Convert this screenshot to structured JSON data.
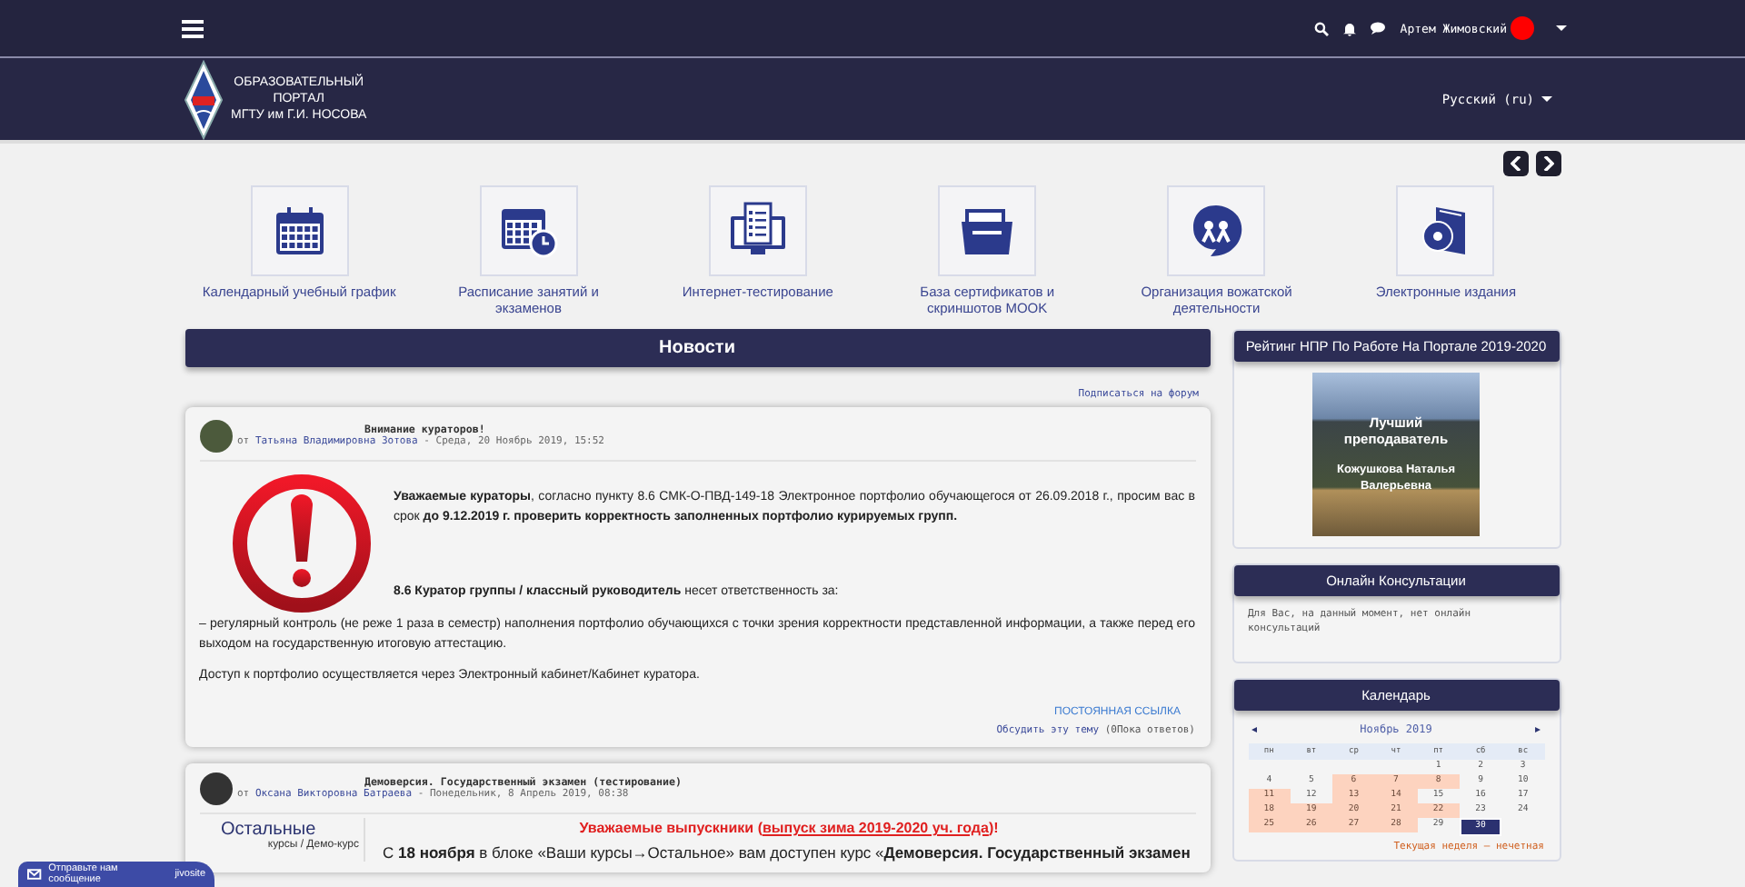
{
  "topbar": {
    "user_name": "Артем Жимовский"
  },
  "header": {
    "logo_text": [
      "ОБРАЗОВАТЕЛЬНЫЙ",
      "ПОРТАЛ",
      "МГТУ им Г.И. НОСОВА"
    ],
    "language": "Русский (ru)"
  },
  "tiles": [
    {
      "label": "Календарный учебный график"
    },
    {
      "label": "Расписание занятий и экзаменов"
    },
    {
      "label": "Интернет-тестирование"
    },
    {
      "label": "База сертификатов и скриншотов MOOK"
    },
    {
      "label": "Организация вожатской деятельности"
    },
    {
      "label": "Электронные издания"
    }
  ],
  "news": {
    "title": "Новости",
    "subscribe": "Подписаться на форум",
    "posts": [
      {
        "title": "Внимание кураторов!",
        "from": "от",
        "author": "Татьяна Владимировна Зотова",
        "date": "- Среда, 20 Ноябрь 2019, 15:52",
        "intro": "**Уважаемые кураторы**, согласно пункту 8.6 СМК-О-ПВД-149-18 Электронное портфолио обучающегося от 26.09.2018 г., просим вас в срок **до 9.12.2019 г. проверить корректность заполненных портфолио курируемых групп.**",
        "duty": "**8.6 Куратор группы / классный руководитель** несет ответственность за:",
        "paragraphs": [
          "– регулярный контроль (не реже 1 раза в семестр) наполнения портфолио обучающихся с точки зрения корректности представленной информации, а также перед его выходом на государственную итоговую аттестацию.",
          "Доступ к портфолио осуществляется через Электронный кабинет/Кабинет куратора."
        ],
        "permalink": "ПОСТОЯННАЯ ССЫЛКА",
        "discuss": "Обсудить эту тему",
        "replies": "(0Пока ответов)"
      },
      {
        "title": "Демоверсия. Государственный экзамен (тестирование)",
        "from": "от",
        "author": "Оксана Викторовна Батраева",
        "date": "- Понедельник, 8 Апрель 2019, 08:38",
        "side_title": "Остальные",
        "side_path": "курсы / Демо-курс",
        "heading_start": "Уважаемые выпускники (",
        "heading_link": "выпуск зима 2019-2020 уч. года",
        "heading_end": ")!",
        "text": "С **18 ноября** в блоке «Ваши курсы→Остальное» вам доступен курс «**Демоверсия. Государственный экзамен**"
      }
    ]
  },
  "rating": {
    "title": "Рейтинг НПР По Работе На Портале 2019-2020",
    "banner_title": "Лучший преподаватель",
    "banner_name": "Кожушкова Наталья Валерьевна"
  },
  "consult": {
    "title": "Онлайн Консультации",
    "text": "Для Вас, на данный момент, нет онлайн консультаций"
  },
  "calendar": {
    "title": "Календарь",
    "prev": "◂",
    "next": "▸",
    "month": "Ноябрь 2019",
    "weekdays": [
      "пн",
      "вт",
      "ср",
      "чт",
      "пт",
      "сб",
      "вс"
    ],
    "weeks": [
      [
        {
          "kind": "blank"
        },
        {
          "kind": "blank"
        },
        {
          "kind": "blank"
        },
        {
          "kind": "blank"
        },
        {
          "day": "1",
          "kind": "plain"
        },
        {
          "day": "2",
          "kind": "plain"
        },
        {
          "day": "3",
          "kind": "plain"
        }
      ],
      [
        {
          "day": "4",
          "kind": "plain"
        },
        {
          "day": "5",
          "kind": "plain"
        },
        {
          "day": "6",
          "kind": "event"
        },
        {
          "day": "7",
          "kind": "event"
        },
        {
          "day": "8",
          "kind": "event"
        },
        {
          "day": "9",
          "kind": "plain"
        },
        {
          "day": "10",
          "kind": "plain"
        }
      ],
      [
        {
          "day": "11",
          "kind": "event"
        },
        {
          "day": "12",
          "kind": "plain"
        },
        {
          "day": "13",
          "kind": "event"
        },
        {
          "day": "14",
          "kind": "event"
        },
        {
          "day": "15",
          "kind": "plain"
        },
        {
          "day": "16",
          "kind": "plain"
        },
        {
          "day": "17",
          "kind": "plain"
        }
      ],
      [
        {
          "day": "18",
          "kind": "event"
        },
        {
          "day": "19",
          "kind": "event"
        },
        {
          "day": "20",
          "kind": "event"
        },
        {
          "day": "21",
          "kind": "event"
        },
        {
          "day": "22",
          "kind": "event"
        },
        {
          "day": "23",
          "kind": "plain"
        },
        {
          "day": "24",
          "kind": "plain"
        }
      ],
      [
        {
          "day": "25",
          "kind": "event"
        },
        {
          "day": "26",
          "kind": "event"
        },
        {
          "day": "27",
          "kind": "event"
        },
        {
          "day": "28",
          "kind": "event"
        },
        {
          "day": "29",
          "kind": "plain"
        },
        {
          "day": "30",
          "kind": "today"
        },
        {
          "kind": "blank"
        }
      ]
    ],
    "note": "Текущая неделя – нечетная"
  },
  "chat_widget": {
    "label": "Отправьте нам сообщение",
    "brand": "jivosite"
  }
}
